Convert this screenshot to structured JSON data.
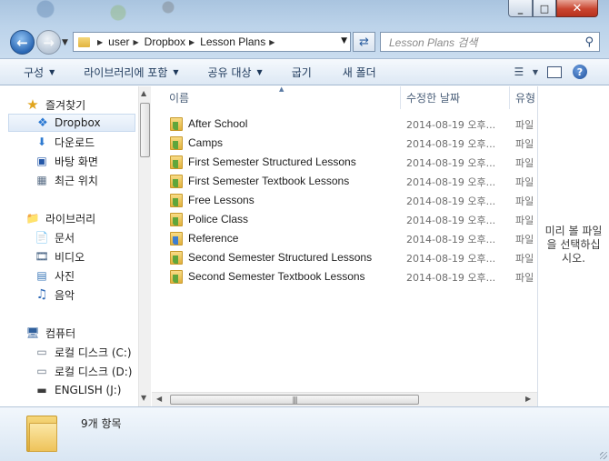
{
  "window": {
    "controls": {
      "minimize": "_",
      "maximize": "□",
      "close": "✕"
    }
  },
  "nav": {
    "back_icon": "back-arrow-icon",
    "forward_icon": "forward-arrow-icon"
  },
  "address": {
    "breadcrumbs": [
      "user",
      "Dropbox",
      "Lesson Plans"
    ]
  },
  "search": {
    "placeholder": "Lesson Plans 검색"
  },
  "toolbar": {
    "organize": "구성",
    "include_in_library": "라이브러리에 포함",
    "share_with": "공유 대상",
    "burn": "굽기",
    "new_folder": "새 폴더",
    "help": "?"
  },
  "sidebar": {
    "favorites": {
      "header": "즐겨찾기",
      "items": [
        {
          "label": "Dropbox",
          "icon": "dropbox-icon",
          "selected": true
        },
        {
          "label": "다운로드",
          "icon": "downloads-icon"
        },
        {
          "label": "바탕 화면",
          "icon": "desktop-icon"
        },
        {
          "label": "최근 위치",
          "icon": "recent-places-icon"
        }
      ]
    },
    "libraries": {
      "header": "라이브러리",
      "items": [
        {
          "label": "문서",
          "icon": "documents-icon"
        },
        {
          "label": "비디오",
          "icon": "videos-icon"
        },
        {
          "label": "사진",
          "icon": "pictures-icon"
        },
        {
          "label": "음악",
          "icon": "music-icon"
        }
      ]
    },
    "computer": {
      "header": "컴퓨터",
      "items": [
        {
          "label": "로컬 디스크 (C:)",
          "icon": "local-disk-c-icon"
        },
        {
          "label": "로컬 디스크 (D:)",
          "icon": "local-disk-d-icon"
        },
        {
          "label": "ENGLISH (J:)",
          "icon": "removable-drive-icon"
        }
      ]
    }
  },
  "filelist": {
    "columns": {
      "name": "이름",
      "modified": "수정한 날짜",
      "type": "유형"
    },
    "rows": [
      {
        "name": "After School",
        "modified": "2014-08-19 오후...",
        "type": "파일"
      },
      {
        "name": "Camps",
        "modified": "2014-08-19 오후...",
        "type": "파일"
      },
      {
        "name": "First Semester Structured Lessons",
        "modified": "2014-08-19 오후...",
        "type": "파일"
      },
      {
        "name": "First Semester Textbook Lessons",
        "modified": "2014-08-19 오후...",
        "type": "파일"
      },
      {
        "name": "Free Lessons",
        "modified": "2014-08-19 오후...",
        "type": "파일"
      },
      {
        "name": "Police Class",
        "modified": "2014-08-19 오후...",
        "type": "파일"
      },
      {
        "name": "Reference",
        "modified": "2014-08-19 오후...",
        "type": "파일"
      },
      {
        "name": "Second Semester Structured Lessons",
        "modified": "2014-08-19 오후...",
        "type": "파일"
      },
      {
        "name": "Second Semester Textbook Lessons",
        "modified": "2014-08-19 오후...",
        "type": "파일"
      }
    ]
  },
  "preview": {
    "message": "미리 볼 파일을 선택하십시오."
  },
  "details": {
    "item_count": "9개 항목"
  }
}
